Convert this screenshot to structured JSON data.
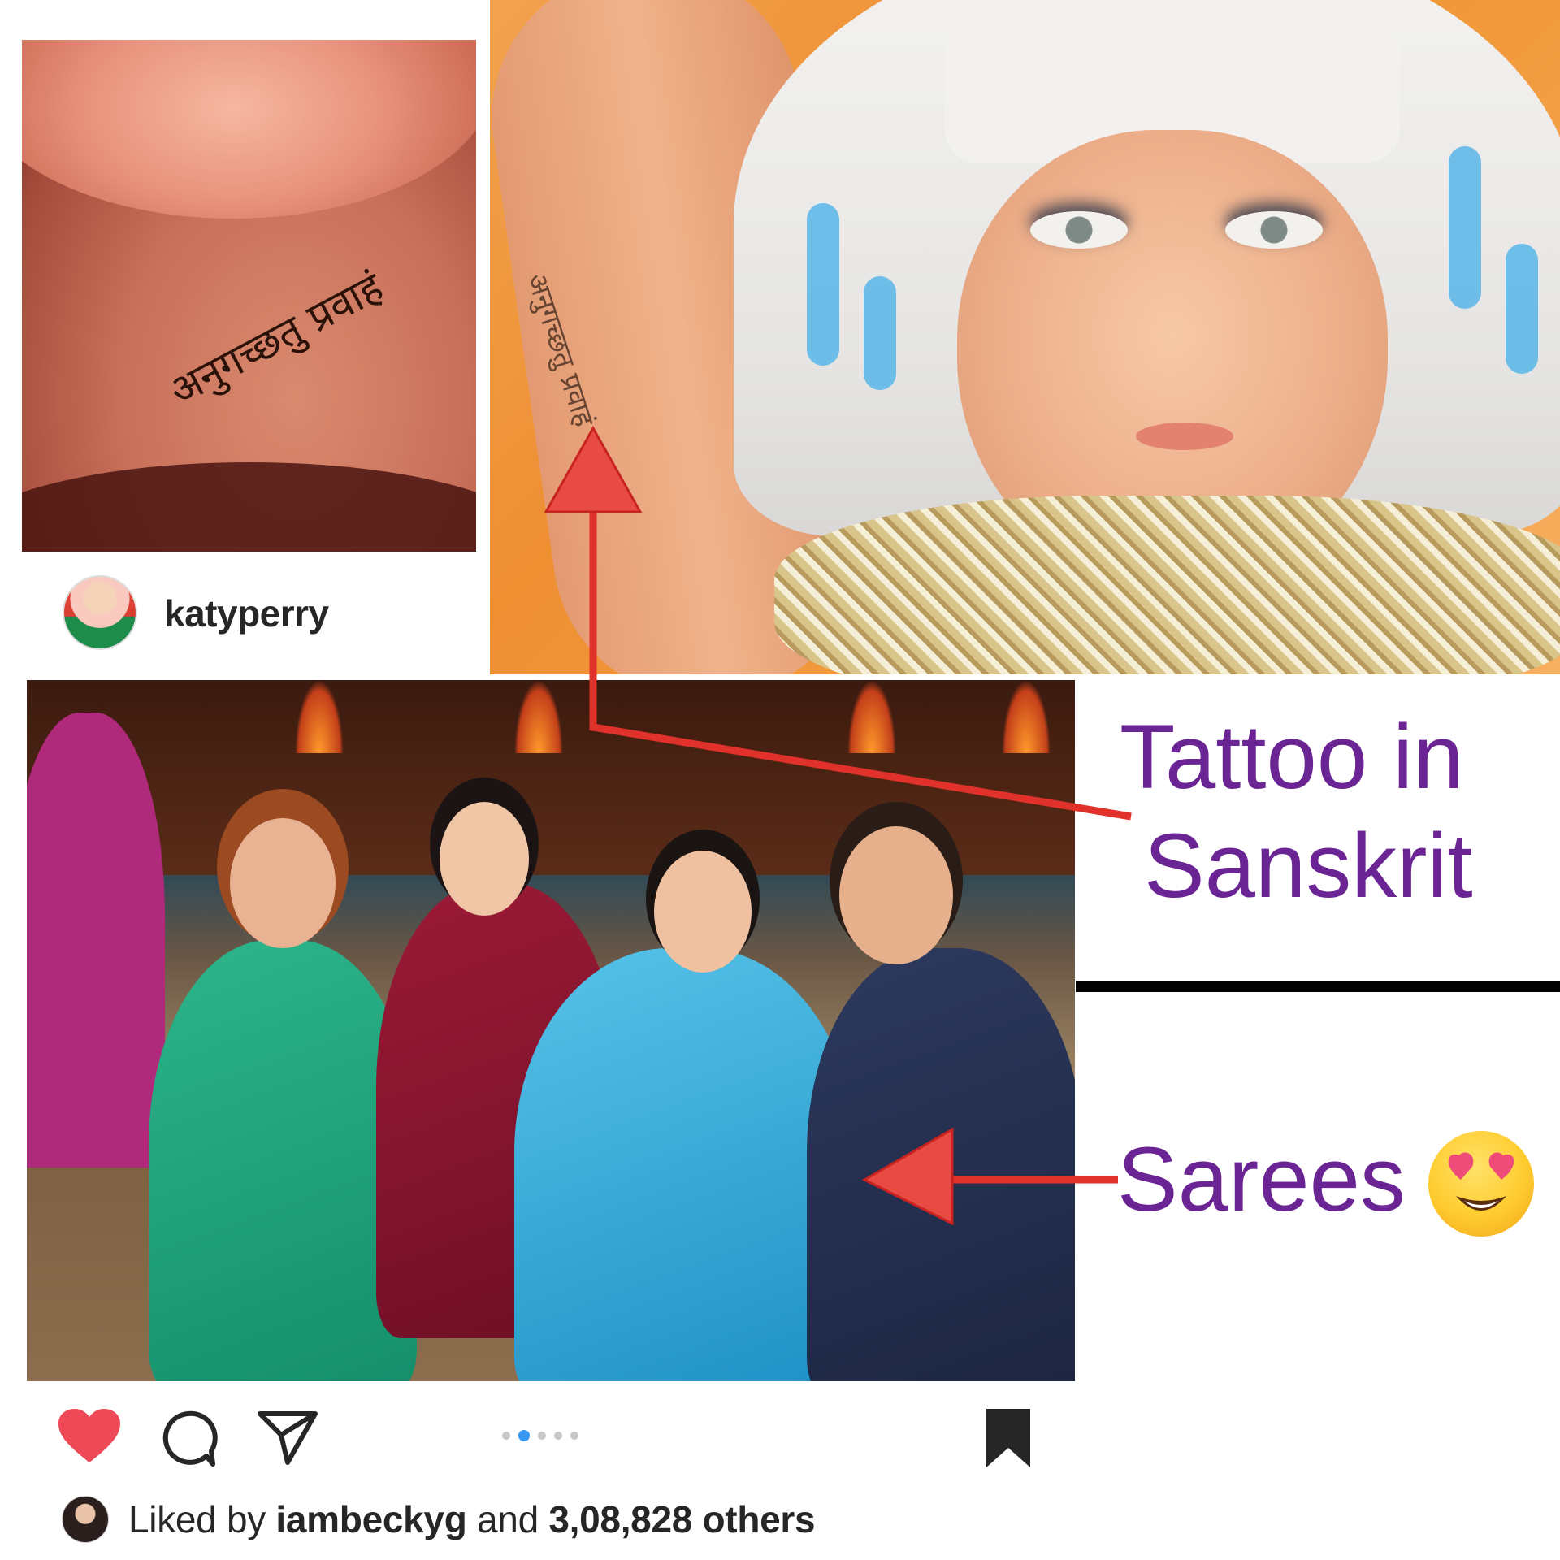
{
  "tattoo_text": "अनुगच्छतु प्रवाहं",
  "post": {
    "username": "katyperry",
    "carousel_dots": 5,
    "carousel_active_index": 1
  },
  "captions": {
    "tattoo_line1": "Tattoo in",
    "tattoo_line2": "Sanskrit",
    "sarees": "Sarees"
  },
  "likes": {
    "prefix": "Liked by",
    "liker": "iambeckyg",
    "connector": "and",
    "count": "3,08,828 others"
  },
  "icons": [
    "heart-icon",
    "comment-icon",
    "share-icon",
    "bookmark-icon",
    "heart-eyes-emoji"
  ],
  "colors": {
    "caption": "#6a2493",
    "arrow": "#e0322a",
    "like_heart": "#ed4956",
    "carousel_active": "#3897f0"
  }
}
